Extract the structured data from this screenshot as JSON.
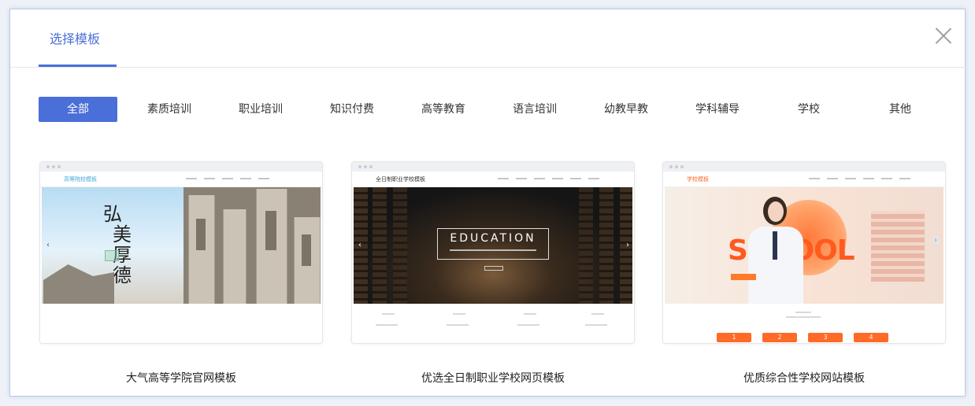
{
  "dialog": {
    "title": "选择模板",
    "close_icon": "close-icon"
  },
  "tabs": [
    {
      "label": "全部",
      "active": true
    },
    {
      "label": "素质培训"
    },
    {
      "label": "职业培训"
    },
    {
      "label": "知识付费"
    },
    {
      "label": "高等教育"
    },
    {
      "label": "语言培训"
    },
    {
      "label": "幼教早教"
    },
    {
      "label": "学科辅导"
    },
    {
      "label": "学校"
    },
    {
      "label": "其他"
    }
  ],
  "templates": [
    {
      "name": "大气高等学院官网模板",
      "preview": {
        "logo": "高等院校模板",
        "calligraphy": [
          "弘",
          "美",
          "厚",
          "德"
        ],
        "logo_color": "#4aa8d8"
      }
    },
    {
      "name": "优选全日制职业学校网页模板",
      "preview": {
        "logo": "全日制职业学校模板",
        "hero_title": "EDUCATION",
        "logo_color": "#333333"
      }
    },
    {
      "name": "优质综合性学校网站模板",
      "preview": {
        "logo": "学校模板",
        "hero_title": "SCHOOL",
        "steps": [
          "1",
          "2",
          "3",
          "4"
        ],
        "logo_color": "#ff6a26"
      }
    }
  ],
  "colors": {
    "accent": "#4a6fd9"
  }
}
